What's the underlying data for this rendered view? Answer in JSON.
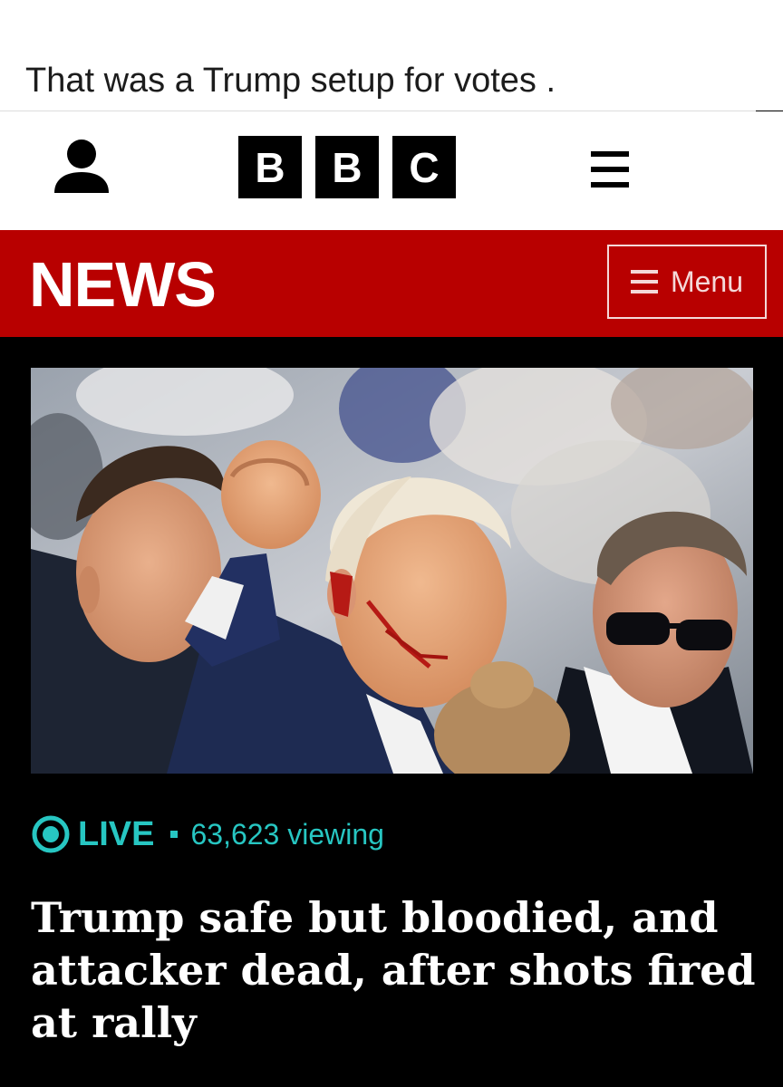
{
  "post": {
    "caption": "That was a Trump setup for votes ."
  },
  "header": {
    "logo_letters": [
      "B",
      "B",
      "C"
    ],
    "account_icon": "person-icon",
    "menu_icon": "hamburger-icon"
  },
  "news_bar": {
    "title": "NEWS",
    "menu_label": "Menu",
    "background_color": "#b80000"
  },
  "live": {
    "label": "LIVE",
    "separator": "▪",
    "viewers": "63,623 viewing",
    "accent_color": "#27c6c2"
  },
  "article": {
    "headline": "Trump safe but bloodied, and attacker dead, after shots fired at rally"
  }
}
